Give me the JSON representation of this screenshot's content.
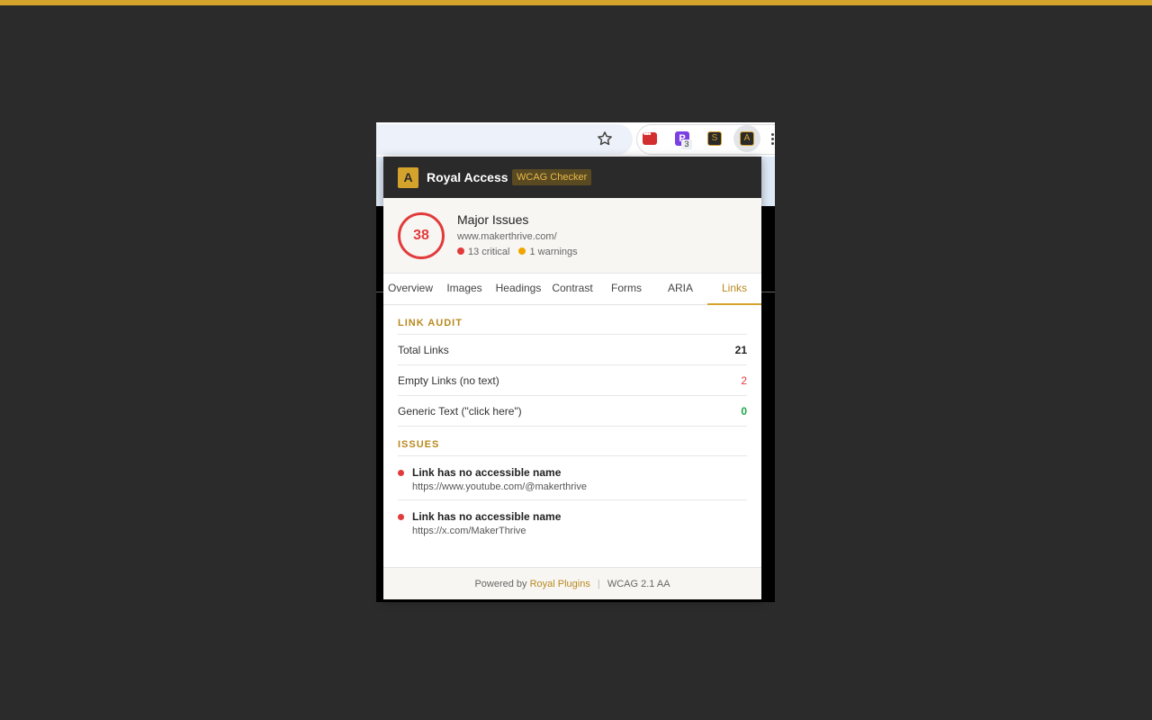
{
  "browser": {
    "extensions": [
      {
        "name": "lastpass-icon"
      },
      {
        "name": "p-extension-icon",
        "label": "P",
        "badge": "3"
      },
      {
        "name": "royal-s-icon",
        "label": "S"
      },
      {
        "name": "royal-access-icon",
        "label": "A"
      }
    ]
  },
  "popup": {
    "header": {
      "logo": "A",
      "title": "Royal Access",
      "badge": "WCAG Checker"
    },
    "score": {
      "value": "38",
      "status": "Major Issues",
      "url": "www.makerthrive.com/",
      "critical": "13 critical",
      "warnings": "1 warnings"
    },
    "tabs": [
      "Overview",
      "Images",
      "Headings",
      "Contrast",
      "Forms",
      "ARIA",
      "Links"
    ],
    "active_tab": "Links",
    "link_audit": {
      "title": "LINK AUDIT",
      "rows": [
        {
          "label": "Total Links",
          "value": "21",
          "color": "#222222"
        },
        {
          "label": "Empty Links (no text)",
          "value": "2",
          "color": "#e23b3b"
        },
        {
          "label": "Generic Text (\"click here\")",
          "value": "0",
          "color": "#1fa64a"
        }
      ]
    },
    "issues": {
      "title": "ISSUES",
      "items": [
        {
          "title": "Link has no accessible name",
          "url": "https://www.youtube.com/@makerthrive"
        },
        {
          "title": "Link has no accessible name",
          "url": "https://x.com/MakerThrive"
        }
      ]
    },
    "footer": {
      "powered_by": "Powered by",
      "link": "Royal Plugins",
      "sep": "|",
      "standard": "WCAG 2.1 AA"
    }
  },
  "colors": {
    "accent": "#d4a32c",
    "critical": "#e23b3b",
    "warning": "#f0a500",
    "success": "#1fa64a"
  }
}
